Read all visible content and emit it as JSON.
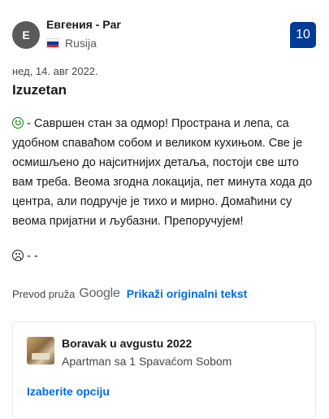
{
  "reviewer": {
    "initial": "E",
    "name": "Евгения - Par",
    "country": "Rusija",
    "flag_colors": [
      "#ffffff",
      "#0039a6",
      "#d52b1e"
    ]
  },
  "score": "10",
  "review": {
    "date": "нед, 14. авг 2022.",
    "title": "Izuzetan",
    "positive_icon": "smiley-happy-icon",
    "positive_text": "- Савршен стан за одмор! Пространа и лепа, са удобном спаваћом собом и великом кухињом. Све је осмишљено до најситнијих детаља, постоји све што вам треба. Веома згодна локација, пет минута хода до центра, али подручје је тихо и мирно. Домаћини су веома пријатни и љубазни. Препоручујем!",
    "negative_icon": "smiley-sad-icon",
    "negative_text": "- -"
  },
  "translation": {
    "label": "Prevod pruža",
    "provider": "Google",
    "show_original": "Prikaži originalni tekst"
  },
  "stay": {
    "title": "Boravak u avgustu 2022",
    "room": "Apartman sa 1 Spavaćom Sobom",
    "select_option": "Izaberite opciju"
  },
  "colors": {
    "score_bg": "#003b95",
    "link": "#006ce4",
    "positive": "#008009"
  }
}
